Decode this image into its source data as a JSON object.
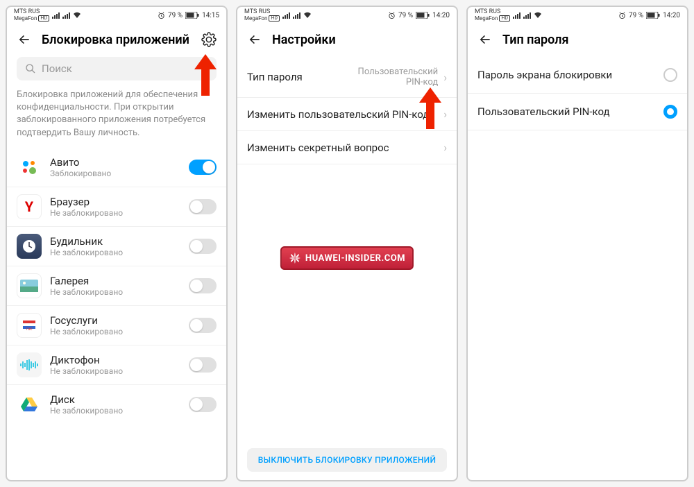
{
  "status": {
    "carrier1": "MTS RUS",
    "carrier2": "MegaFon",
    "hd": "HD",
    "battery": "79 %",
    "time1": "14:15",
    "time2": "14:20",
    "time3": "14:20",
    "alarm_icon": "alarm",
    "battery_icon": "battery"
  },
  "screen1": {
    "title": "Блокировка приложений",
    "search_placeholder": "Поиск",
    "description": "Блокировка приложений для обеспечения конфиденциальности. При открытии заблокированного приложения потребуется подтвердить Вашу личность.",
    "apps": [
      {
        "name": "Авито",
        "status": "Заблокировано",
        "locked": true,
        "icon": "avito"
      },
      {
        "name": "Браузер",
        "status": "Не заблокировано",
        "locked": false,
        "icon": "yandex"
      },
      {
        "name": "Будильник",
        "status": "Не заблокировано",
        "locked": false,
        "icon": "clock"
      },
      {
        "name": "Галерея",
        "status": "Не заблокировано",
        "locked": false,
        "icon": "gallery"
      },
      {
        "name": "Госуслуги",
        "status": "Не заблокировано",
        "locked": false,
        "icon": "gosuslugi"
      },
      {
        "name": "Диктофон",
        "status": "Не заблокировано",
        "locked": false,
        "icon": "dictaphone"
      },
      {
        "name": "Диск",
        "status": "Не заблокировано",
        "locked": false,
        "icon": "drive"
      }
    ]
  },
  "screen2": {
    "title": "Настройки",
    "rows": [
      {
        "label": "Тип пароля",
        "value": "Пользовательский PIN-код"
      },
      {
        "label": "Изменить пользовательский PIN-код",
        "value": ""
      },
      {
        "label": "Изменить секретный вопрос",
        "value": ""
      }
    ],
    "disable_button": "ВЫКЛЮЧИТЬ БЛОКИРОВКУ ПРИЛОЖЕНИЙ",
    "watermark": "HUAWEI-INSIDER.COM"
  },
  "screen3": {
    "title": "Тип пароля",
    "options": [
      {
        "label": "Пароль экрана блокировки",
        "selected": false
      },
      {
        "label": "Пользовательский PIN-код",
        "selected": true
      }
    ]
  }
}
